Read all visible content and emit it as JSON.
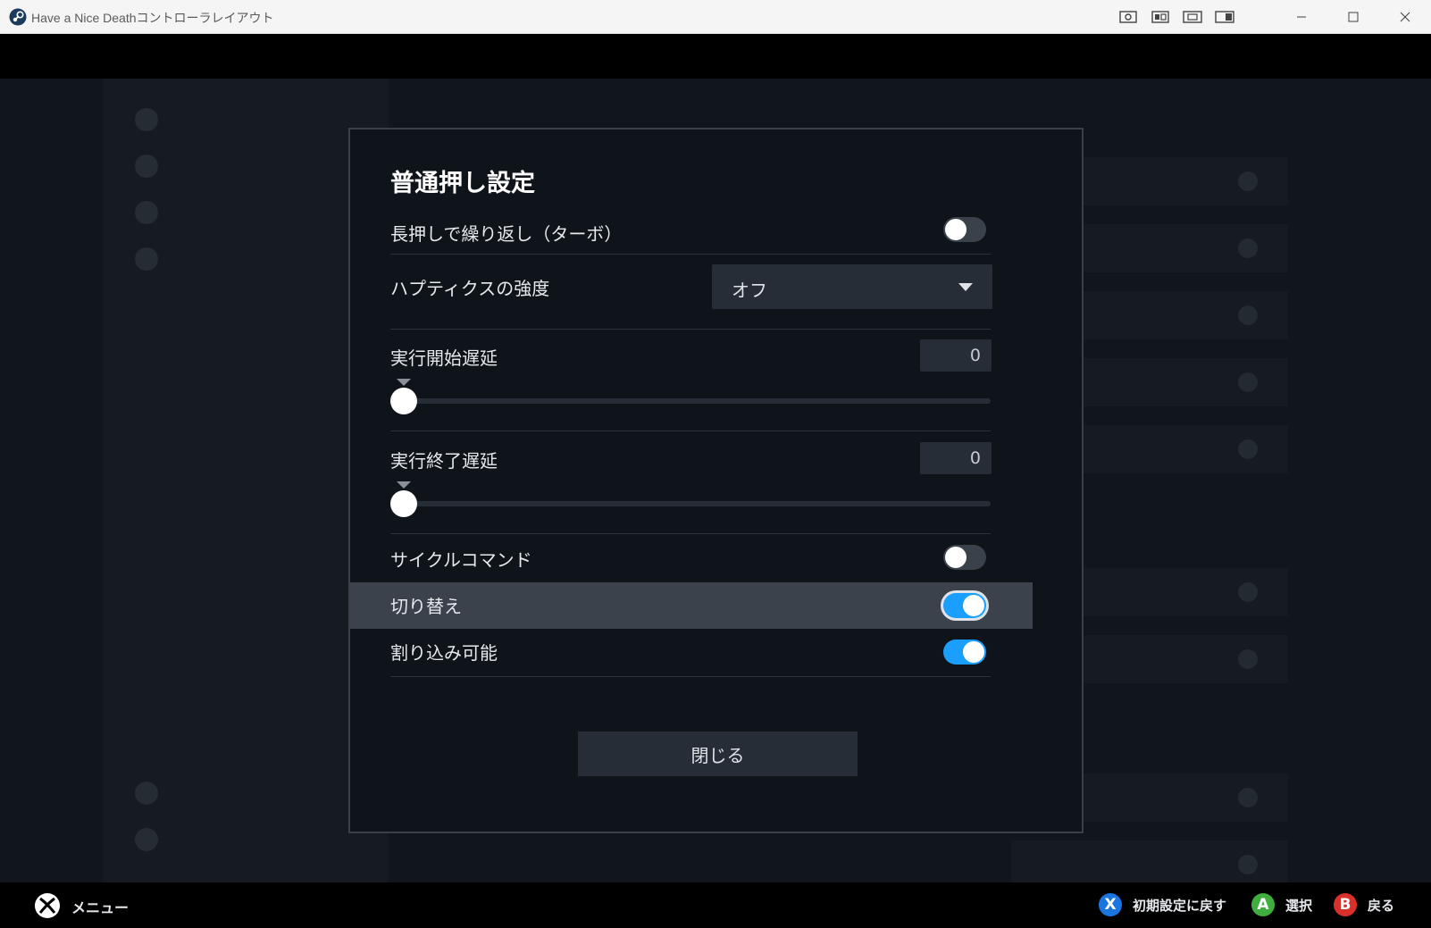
{
  "window": {
    "title": "Have a Nice Deathコントローラレイアウト",
    "accent": "#1a9fff"
  },
  "dialog": {
    "title": "普通押し設定",
    "turbo": {
      "label": "長押しで繰り返し（ターボ）",
      "on": false
    },
    "haptics": {
      "label": "ハプティクスの強度",
      "value": "オフ"
    },
    "start_delay": {
      "label": "実行開始遅延",
      "value": "0",
      "slider_fraction": 0
    },
    "end_delay": {
      "label": "実行終了遅延",
      "value": "0",
      "slider_fraction": 0
    },
    "cycle": {
      "label": "サイクルコマンド",
      "on": false
    },
    "toggle": {
      "label": "切り替え",
      "on": true
    },
    "interruptible": {
      "label": "割り込み可能",
      "on": true
    },
    "close_label": "閉じる"
  },
  "footer": {
    "menu_label": "メニュー",
    "hints": [
      {
        "button": "X",
        "label": "初期設定に戻す",
        "color": "#1a75e0"
      },
      {
        "button": "A",
        "label": "選択",
        "color": "#3fae3f"
      },
      {
        "button": "B",
        "label": "戻る",
        "color": "#d8302b"
      }
    ]
  }
}
